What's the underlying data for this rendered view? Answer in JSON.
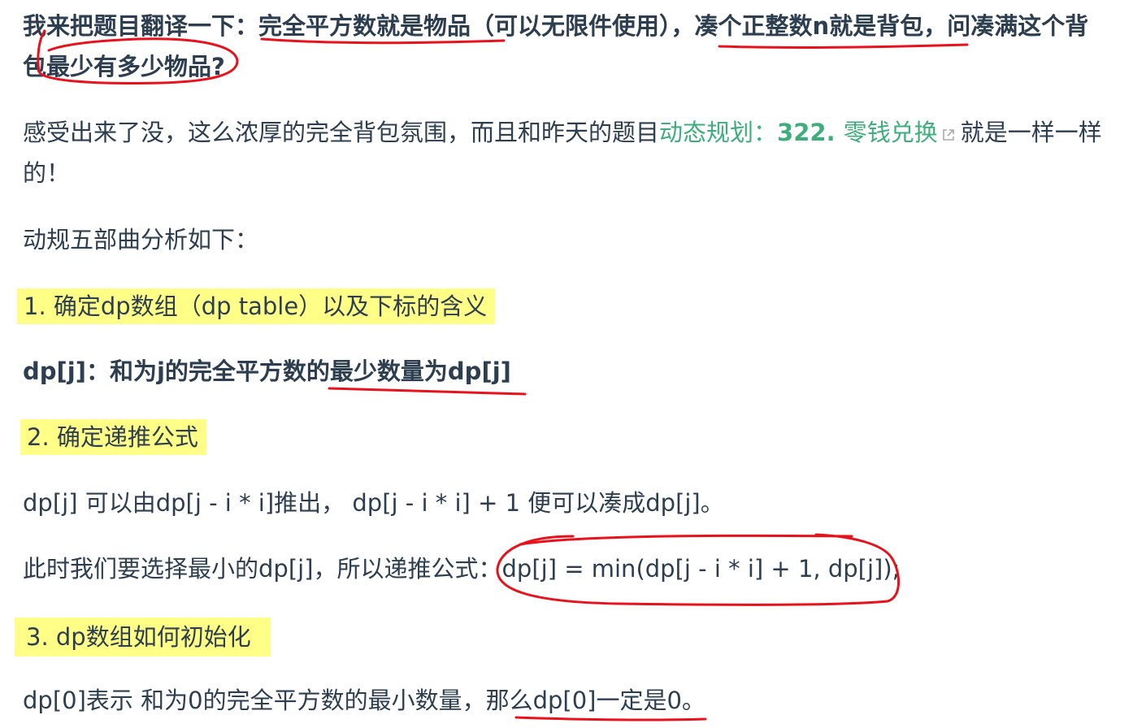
{
  "paragraph1": {
    "line1": {
      "a": "我来把题目翻译一下：",
      "b": "完全平方数就是物品",
      "c": "（可以无限件使用），",
      "d": "凑个正整数n就是背包",
      "e": "，问凑满这个背"
    },
    "line2": {
      "a": "包",
      "b": "最少有多少物品?"
    }
  },
  "paragraph2": {
    "line1": {
      "text": "感受出来了没，这么浓厚的完全背包氛围，而且和昨天的题目",
      "link_prefix": "动态规划：",
      "link_number": "322. ",
      "link_title": "零钱兑换",
      "link_icon": "external-link-icon",
      "after": "就是一样一样"
    },
    "line2": "的！"
  },
  "intro": "动规五部曲分析如下：",
  "step1": {
    "heading": "1. 确定dp数组（dp table）以及下标的含义",
    "definition_a": "dp[j]：和为j的完全平方数的",
    "definition_b": "最少数量为dp[j]"
  },
  "step2": {
    "heading": "2. 确定递推公式",
    "derivation": "dp[j] 可以由dp[j - i * i]推出， dp[j - i * i] + 1 便可以凑成dp[j]。",
    "formula_intro": "此时我们要选择最小的dp[j]，所以递推公式：",
    "formula": "dp[j] = min(dp[j - i * i] + 1, dp[j]);"
  },
  "step3": {
    "heading": "3. dp数组如何初始化",
    "init_a": "dp[0]表示 和为0的完全平方数的最小数量，那么",
    "init_b": "dp[0]一定是0。"
  },
  "colors": {
    "text": "#2c3e50",
    "link": "#3eaf7c",
    "highlight": "#ffff88",
    "annotation": "#e8121c"
  }
}
